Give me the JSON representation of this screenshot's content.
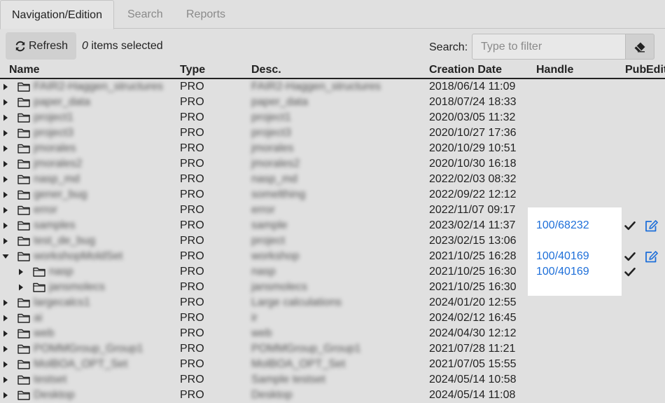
{
  "tabs": [
    {
      "label": "Navigation/Edition",
      "active": true
    },
    {
      "label": "Search",
      "active": false
    },
    {
      "label": "Reports",
      "active": false
    }
  ],
  "toolbar": {
    "refresh_label": "Refresh",
    "selected_count": "0",
    "selected_suffix": " items selected",
    "search_label": "Search:",
    "search_placeholder": "Type to filter",
    "search_value": ""
  },
  "table": {
    "columns": {
      "name": "Name",
      "type": "Type",
      "desc": "Desc.",
      "date": "Creation Date",
      "handle": "Handle",
      "pub": "Pub",
      "edit": "Edit"
    },
    "rows": [
      {
        "level": 0,
        "expanded": false,
        "name": "FAIR2-Haggen_structures",
        "type": "PRO",
        "desc": "FAIR2-Haggen_structures",
        "date": "2018/06/14 11:09",
        "handle": "",
        "pub": false,
        "edit": false
      },
      {
        "level": 0,
        "expanded": false,
        "name": "paper_data",
        "type": "PRO",
        "desc": "paper_data",
        "date": "2018/07/24 18:33",
        "handle": "",
        "pub": false,
        "edit": false
      },
      {
        "level": 0,
        "expanded": false,
        "name": "project1",
        "type": "PRO",
        "desc": "project1",
        "date": "2020/03/05 11:32",
        "handle": "",
        "pub": false,
        "edit": false
      },
      {
        "level": 0,
        "expanded": false,
        "name": "project3",
        "type": "PRO",
        "desc": "project3",
        "date": "2020/10/27 17:36",
        "handle": "",
        "pub": false,
        "edit": false
      },
      {
        "level": 0,
        "expanded": false,
        "name": "jmorales",
        "type": "PRO",
        "desc": "jmorales",
        "date": "2020/10/29 10:51",
        "handle": "",
        "pub": false,
        "edit": false
      },
      {
        "level": 0,
        "expanded": false,
        "name": "jmorales2",
        "type": "PRO",
        "desc": "jmorales2",
        "date": "2020/10/30 16:18",
        "handle": "",
        "pub": false,
        "edit": false
      },
      {
        "level": 0,
        "expanded": false,
        "name": "nasp_md",
        "type": "PRO",
        "desc": "nasp_md",
        "date": "2022/02/03 08:32",
        "handle": "",
        "pub": false,
        "edit": false
      },
      {
        "level": 0,
        "expanded": false,
        "name": "gener_bug",
        "type": "PRO",
        "desc": "somelthing",
        "date": "2022/09/22 12:12",
        "handle": "",
        "pub": false,
        "edit": false
      },
      {
        "level": 0,
        "expanded": false,
        "name": "error",
        "type": "PRO",
        "desc": "error",
        "date": "2022/11/07 09:17",
        "handle": "",
        "pub": false,
        "edit": false
      },
      {
        "level": 0,
        "expanded": false,
        "name": "samples",
        "type": "PRO",
        "desc": "sample",
        "date": "2023/02/14 11:37",
        "handle": "100/68232",
        "pub": true,
        "edit": true
      },
      {
        "level": 0,
        "expanded": false,
        "name": "test_de_bug",
        "type": "PRO",
        "desc": "project",
        "date": "2023/02/15 13:06",
        "handle": "",
        "pub": false,
        "edit": false
      },
      {
        "level": 0,
        "expanded": true,
        "name": "workshopMoldSet",
        "type": "PRO",
        "desc": "workshop",
        "date": "2021/10/25 16:28",
        "handle": "100/40169",
        "pub": true,
        "edit": true
      },
      {
        "level": 1,
        "expanded": false,
        "name": "nasp",
        "type": "PRO",
        "desc": "nasp",
        "date": "2021/10/25 16:30",
        "handle": "100/40169",
        "pub": true,
        "edit": false
      },
      {
        "level": 1,
        "expanded": false,
        "name": "jansmolecs",
        "type": "PRO",
        "desc": "jansmolecs",
        "date": "2021/10/25 16:30",
        "handle": "",
        "pub": false,
        "edit": false
      },
      {
        "level": 0,
        "expanded": false,
        "name": "largecalcs1",
        "type": "PRO",
        "desc": "Large calculations",
        "date": "2024/01/20 12:55",
        "handle": "",
        "pub": false,
        "edit": false
      },
      {
        "level": 0,
        "expanded": false,
        "name": "ai",
        "type": "PRO",
        "desc": "ir",
        "date": "2024/02/12 16:45",
        "handle": "",
        "pub": false,
        "edit": false
      },
      {
        "level": 0,
        "expanded": false,
        "name": "web",
        "type": "PRO",
        "desc": "web",
        "date": "2024/04/30 12:12",
        "handle": "",
        "pub": false,
        "edit": false
      },
      {
        "level": 0,
        "expanded": false,
        "name": "POMMGroup_Group1",
        "type": "PRO",
        "desc": "POMMGroup_Group1",
        "date": "2021/07/28 11:21",
        "handle": "",
        "pub": false,
        "edit": false
      },
      {
        "level": 0,
        "expanded": false,
        "name": "MolBOA_OPT_Set",
        "type": "PRO",
        "desc": "MolBOA_OPT_Set",
        "date": "2021/07/05 15:55",
        "handle": "",
        "pub": false,
        "edit": false
      },
      {
        "level": 0,
        "expanded": false,
        "name": "testset",
        "type": "PRO",
        "desc": "Sample testset",
        "date": "2024/05/14 10:58",
        "handle": "",
        "pub": false,
        "edit": false
      },
      {
        "level": 0,
        "expanded": false,
        "name": "Desktop",
        "type": "PRO",
        "desc": "Desktop",
        "date": "2024/05/14 11:08",
        "handle": "",
        "pub": false,
        "edit": false
      }
    ]
  }
}
